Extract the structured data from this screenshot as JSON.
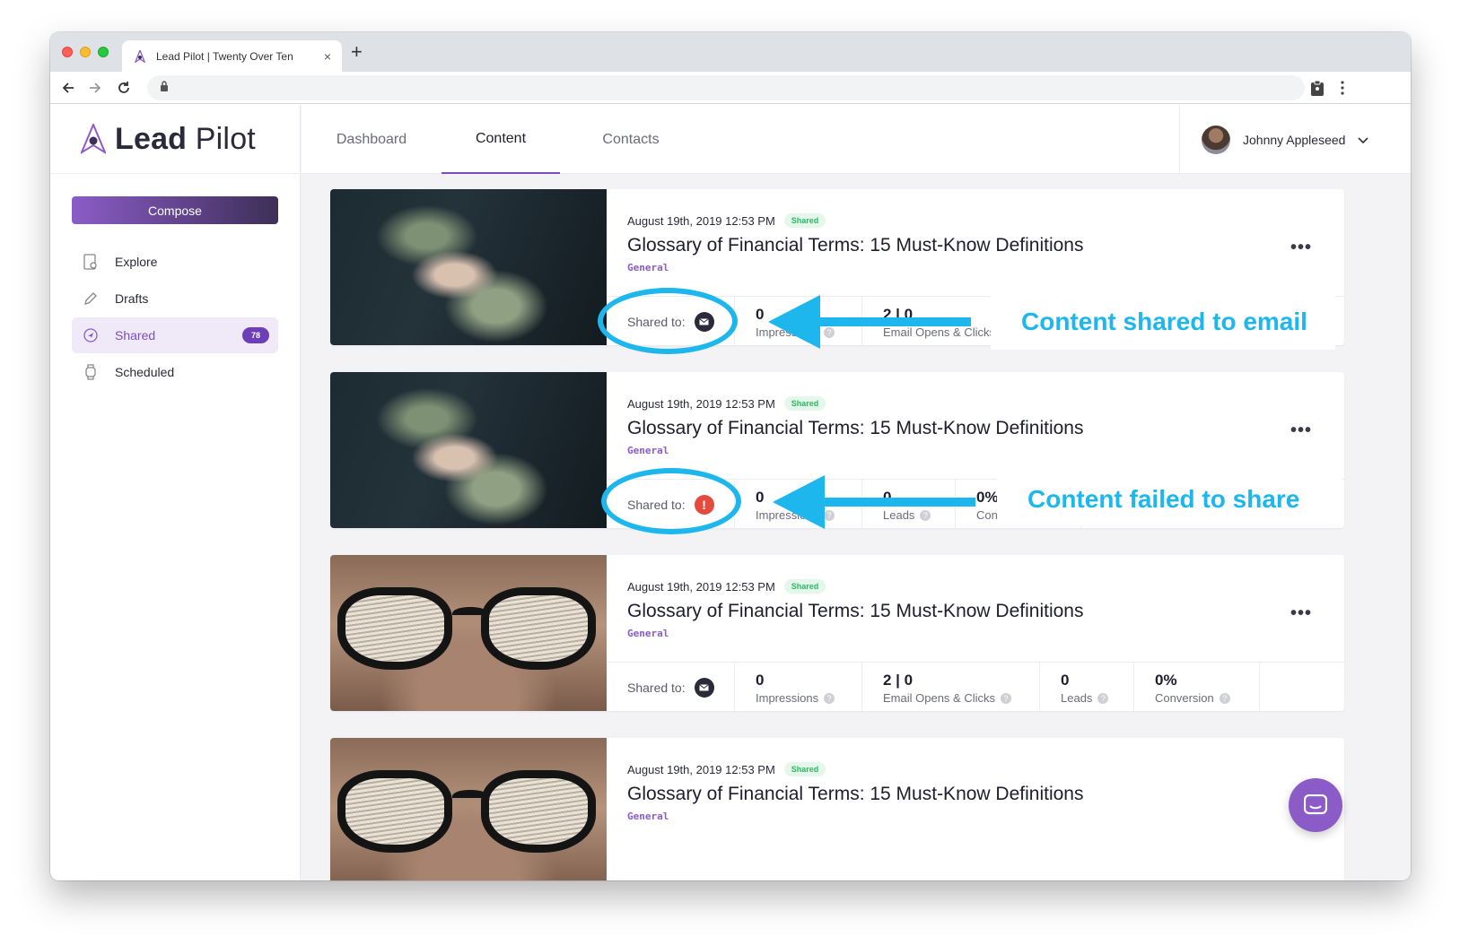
{
  "browser": {
    "tab_title": "Lead Pilot | Twenty Over Ten",
    "tab_close": "×",
    "new_tab": "+"
  },
  "app": {
    "logo_bold": "Lead",
    "logo_light": " Pilot",
    "compose_label": "Compose",
    "sidebar": {
      "items": [
        {
          "label": "Explore",
          "icon": "explore-icon"
        },
        {
          "label": "Drafts",
          "icon": "pencil-icon"
        },
        {
          "label": "Shared",
          "icon": "send-icon",
          "badge": "78",
          "active": true
        },
        {
          "label": "Scheduled",
          "icon": "watch-icon"
        }
      ]
    },
    "topnav": {
      "tabs": [
        {
          "label": "Dashboard"
        },
        {
          "label": "Content",
          "active": true
        },
        {
          "label": "Contacts"
        }
      ],
      "user_name": "Johnny Appleseed"
    }
  },
  "cards": [
    {
      "date": "August 19th, 2019 12:53 PM",
      "status": "Shared",
      "title": "Glossary of Financial Terms: 15 Must-Know Definitions",
      "category": "General",
      "shared_to_label": "Shared to:",
      "channel": "email",
      "stats": [
        {
          "value": "0",
          "label": "Impressions"
        },
        {
          "value": "2 | 0",
          "label": "Email Opens & Clicks"
        }
      ]
    },
    {
      "date": "August 19th, 2019 12:53 PM",
      "status": "Shared",
      "title": "Glossary of Financial Terms: 15 Must-Know Definitions",
      "category": "General",
      "shared_to_label": "Shared to:",
      "channel": "error",
      "stats": [
        {
          "value": "0",
          "label": "Impressions"
        },
        {
          "value": "0",
          "label": "Leads"
        },
        {
          "value": "0%",
          "label": "Conversion"
        }
      ]
    },
    {
      "date": "August 19th, 2019 12:53 PM",
      "status": "Shared",
      "title": "Glossary of Financial Terms: 15 Must-Know Definitions",
      "category": "General",
      "shared_to_label": "Shared to:",
      "channel": "email",
      "stats": [
        {
          "value": "0",
          "label": "Impressions"
        },
        {
          "value": "2 | 0",
          "label": "Email Opens & Clicks"
        },
        {
          "value": "0",
          "label": "Leads"
        },
        {
          "value": "0%",
          "label": "Conversion"
        }
      ]
    },
    {
      "date": "August 19th, 2019 12:53 PM",
      "status": "Shared",
      "title": "Glossary of Financial Terms: 15 Must-Know Definitions",
      "category": "General"
    }
  ],
  "annotations": {
    "email": "Content shared to email",
    "failed": "Content failed to share"
  },
  "colors": {
    "accent": "#8b5cc8",
    "annotation": "#1db7ee",
    "success": "#2eb864",
    "error": "#e34b3f"
  }
}
